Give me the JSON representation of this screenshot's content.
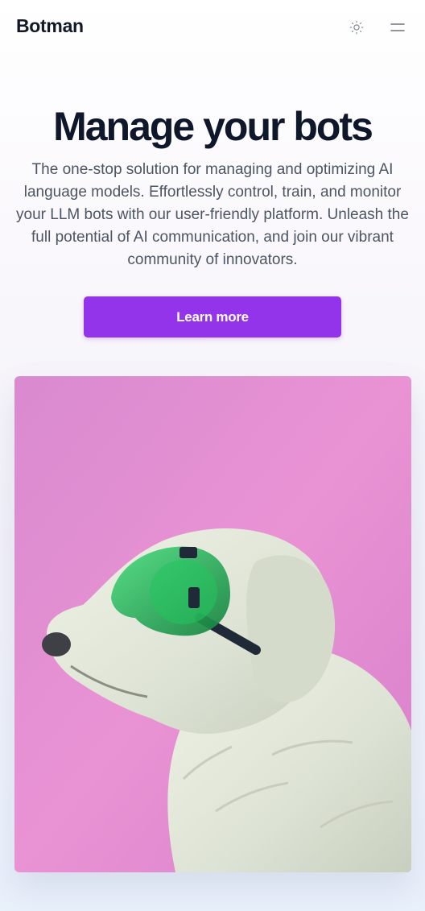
{
  "header": {
    "brand": "Botman",
    "theme_toggle_icon": "sun-icon",
    "menu_icon": "hamburger-menu-icon"
  },
  "hero": {
    "title": "Manage your bots",
    "description": "The one-stop solution for managing and optimizing AI language models. Effortlessly control, train, and monitor your LLM bots with our user-friendly platform. Unleash the full potential of AI communication, and join our vibrant community of innovators.",
    "cta_label": "Learn more"
  },
  "colors": {
    "accent": "#9333ea",
    "heading": "#0f172a",
    "body_text": "#4b5563",
    "image_background": "#e68fd0",
    "goggles": "#22c55e"
  }
}
